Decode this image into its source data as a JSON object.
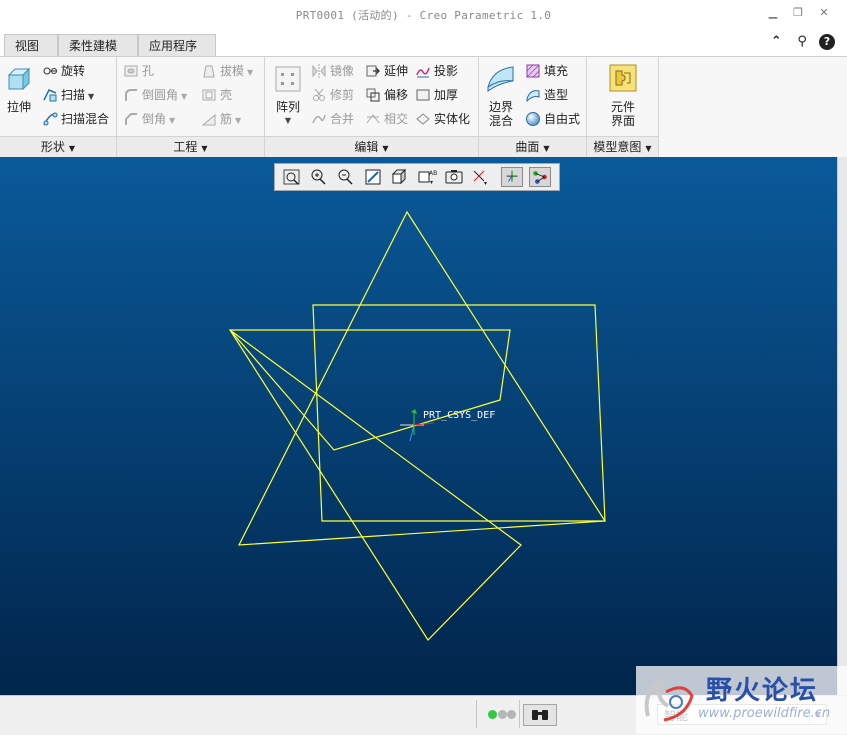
{
  "window": {
    "title": "PRT0001 (活动的) - Creo Parametric 1.0",
    "controls": [
      "minimize-icon",
      "restore-icon",
      "close-icon"
    ]
  },
  "tabs": [
    {
      "label": "视图"
    },
    {
      "label": "柔性建模"
    },
    {
      "label": "应用程序"
    }
  ],
  "help_icons": [
    "collapse-ribbon-icon",
    "search-icon",
    "help-icon"
  ],
  "ribbon": {
    "shape": {
      "label": "形状",
      "extrude": "拉伸",
      "revolve": "旋转",
      "sweep": "扫描",
      "swept_blend": "扫描混合"
    },
    "engineering": {
      "label": "工程",
      "hole": "孔",
      "round": "倒圆角",
      "chamfer": "倒角",
      "draft": "拔模",
      "shell": "壳",
      "rib": "筋"
    },
    "editing": {
      "label": "编辑",
      "pattern": "阵列",
      "mirror": "镜像",
      "trim": "修剪",
      "merge": "合并",
      "extend": "延伸",
      "offset": "偏移",
      "intersect": "相交",
      "project": "投影",
      "thicken": "加厚",
      "solidify": "实体化"
    },
    "surfaces": {
      "label": "曲面",
      "boundary_blend": [
        "边界",
        "混合"
      ],
      "fill": "填充",
      "style": "造型",
      "freestyle": "自由式"
    },
    "model_intent": {
      "label": "模型意图",
      "component_interface": [
        "元件",
        "界面"
      ]
    }
  },
  "view_toolbar": [
    "refit-icon",
    "zoom-in-icon",
    "zoom-out-icon",
    "repaint-icon",
    "display-style-icon",
    "saved-views-icon",
    "view-manager-icon",
    "datum-display-icon",
    "spin-center-icon",
    "annotation-display-icon"
  ],
  "graphics": {
    "csys_label": "PRT_CSYS_DEF",
    "sketch_color": "#ffff33",
    "bg_top": "#0a5a9a",
    "bg_bottom": "#01254b"
  },
  "status": {
    "filter_value": "智能",
    "indicator_colors": [
      "#2ecc40",
      "#b5b5b5",
      "#b5b5b5"
    ]
  },
  "watermark": {
    "title": "野火论坛",
    "url": "www.proewildfire.cn"
  }
}
